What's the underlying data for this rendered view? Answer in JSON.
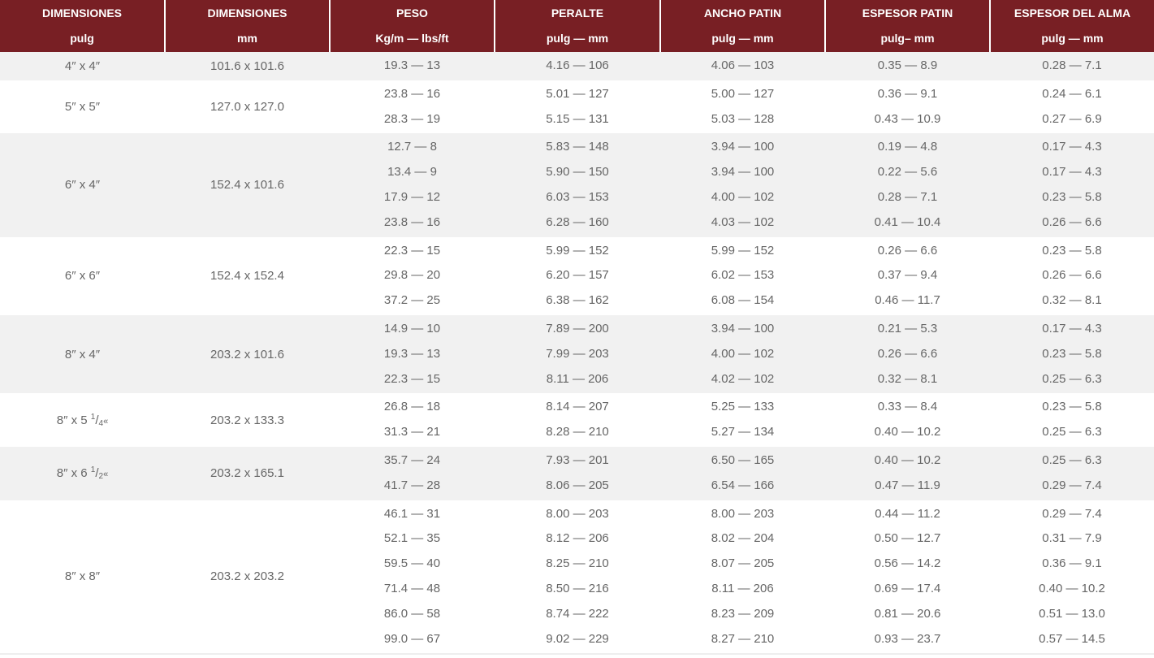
{
  "headers": [
    {
      "line1": "DIMENSIONES",
      "line2": "pulg"
    },
    {
      "line1": "DIMENSIONES",
      "line2": "mm"
    },
    {
      "line1": "PESO",
      "line2": "Kg/m — lbs/ft"
    },
    {
      "line1": "PERALTE",
      "line2": "pulg — mm"
    },
    {
      "line1": "ANCHO PATIN",
      "line2": "pulg — mm"
    },
    {
      "line1": "ESPESOR PATIN",
      "line2": "pulg– mm"
    },
    {
      "line1": "ESPESOR DEL ALMA",
      "line2": "pulg — mm"
    }
  ],
  "colors": {
    "header_bg": "#781f24",
    "header_text": "#ffffff",
    "row_alt": "#f1f1f1",
    "row_text": "#666666"
  },
  "groups": [
    {
      "dim_in": "4″ x 4″",
      "dim_mm": "101.6 x 101.6",
      "peso": [
        "19.3 — 13"
      ],
      "peralte": [
        "4.16 — 106"
      ],
      "ancho": [
        "4.06 — 103"
      ],
      "espesor_patin": [
        "0.35 — 8.9"
      ],
      "espesor_alma": [
        "0.28 — 7.1"
      ]
    },
    {
      "dim_in": "5″ x 5″",
      "dim_mm": "127.0 x 127.0",
      "peso": [
        "23.8 — 16",
        "28.3 — 19"
      ],
      "peralte": [
        "5.01 — 127",
        "5.15 — 131"
      ],
      "ancho": [
        "5.00 — 127",
        "5.03 — 128"
      ],
      "espesor_patin": [
        "0.36 — 9.1",
        "0.43 — 10.9"
      ],
      "espesor_alma": [
        "0.24 — 6.1",
        "0.27 — 6.9"
      ]
    },
    {
      "dim_in": "6″ x 4″",
      "dim_mm": "152.4 x 101.6",
      "peso": [
        "12.7 — 8",
        "13.4 — 9",
        "17.9 — 12",
        "23.8 — 16"
      ],
      "peralte": [
        "5.83 — 148",
        "5.90 — 150",
        "6.03 — 153",
        "6.28 — 160"
      ],
      "ancho": [
        "3.94 — 100",
        "3.94 — 100",
        "4.00 — 102",
        "4.03 — 102"
      ],
      "espesor_patin": [
        "0.19 — 4.8",
        "0.22 — 5.6",
        "0.28 — 7.1",
        "0.41 — 10.4"
      ],
      "espesor_alma": [
        "0.17 — 4.3",
        "0.17 — 4.3",
        "0.23 — 5.8",
        "0.26 — 6.6"
      ]
    },
    {
      "dim_in": "6″ x 6″",
      "dim_mm": "152.4 x 152.4",
      "peso": [
        "22.3 — 15",
        "29.8 — 20",
        "37.2 — 25"
      ],
      "peralte": [
        "5.99 — 152",
        "6.20 — 157",
        "6.38 — 162"
      ],
      "ancho": [
        "5.99 — 152",
        "6.02 — 153",
        "6.08 — 154"
      ],
      "espesor_patin": [
        "0.26 — 6.6",
        "0.37 — 9.4",
        "0.46 — 11.7"
      ],
      "espesor_alma": [
        "0.23 — 5.8",
        "0.26 — 6.6",
        "0.32 — 8.1"
      ]
    },
    {
      "dim_in": "8″ x 4″",
      "dim_mm": "203.2 x 101.6",
      "peso": [
        "14.9 — 10",
        "19.3 — 13",
        "22.3 — 15"
      ],
      "peralte": [
        "7.89 — 200",
        "7.99 — 203",
        "8.11 — 206"
      ],
      "ancho": [
        "3.94 — 100",
        "4.00 — 102",
        "4.02 — 102"
      ],
      "espesor_patin": [
        "0.21 — 5.3",
        "0.26 — 6.6",
        "0.32 — 8.1"
      ],
      "espesor_alma": [
        "0.17 — 4.3",
        "0.23 — 5.8",
        "0.25 — 6.3"
      ]
    },
    {
      "dim_in": "8″ x 5",
      "dim_frac_num": "1",
      "dim_frac_den": "4",
      "dim_suffix": "«",
      "dim_mm": "203.2 x 133.3",
      "peso": [
        "26.8 — 18",
        "31.3 — 21"
      ],
      "peralte": [
        "8.14 — 207",
        "8.28 — 210"
      ],
      "ancho": [
        "5.25 — 133",
        "5.27 — 134"
      ],
      "espesor_patin": [
        "0.33 — 8.4",
        "0.40 — 10.2"
      ],
      "espesor_alma": [
        "0.23 — 5.8",
        "0.25 — 6.3"
      ]
    },
    {
      "dim_in": "8″ x 6",
      "dim_frac_num": "1",
      "dim_frac_den": "2",
      "dim_suffix": "«",
      "dim_mm": "203.2 x 165.1",
      "peso": [
        "35.7 — 24",
        "41.7 — 28"
      ],
      "peralte": [
        "7.93 — 201",
        "8.06 — 205"
      ],
      "ancho": [
        "6.50 — 165",
        "6.54 — 166"
      ],
      "espesor_patin": [
        "0.40 — 10.2",
        "0.47 — 11.9"
      ],
      "espesor_alma": [
        "0.25 — 6.3",
        "0.29 — 7.4"
      ]
    },
    {
      "dim_in": "8″ x 8″",
      "dim_mm": "203.2 x 203.2",
      "peso": [
        "46.1 — 31",
        "52.1 — 35",
        "59.5 — 40",
        "71.4 — 48",
        "86.0 — 58",
        "99.0 — 67"
      ],
      "peralte": [
        "8.00 — 203",
        "8.12 — 206",
        "8.25 — 210",
        "8.50 — 216",
        "8.74 — 222",
        "9.02 — 229"
      ],
      "ancho": [
        "8.00 — 203",
        "8.02 — 204",
        "8.07 — 205",
        "8.11 — 206",
        "8.23 — 209",
        "8.27 — 210"
      ],
      "espesor_patin": [
        "0.44 — 11.2",
        "0.50 — 12.7",
        "0.56 — 14.2",
        "0.69 — 17.4",
        "0.81 — 20.6",
        "0.93 — 23.7"
      ],
      "espesor_alma": [
        "0.29 — 7.4",
        "0.31 — 7.9",
        "0.36 — 9.1",
        "0.40 — 10.2",
        "0.51 — 13.0",
        "0.57 — 14.5"
      ]
    }
  ]
}
